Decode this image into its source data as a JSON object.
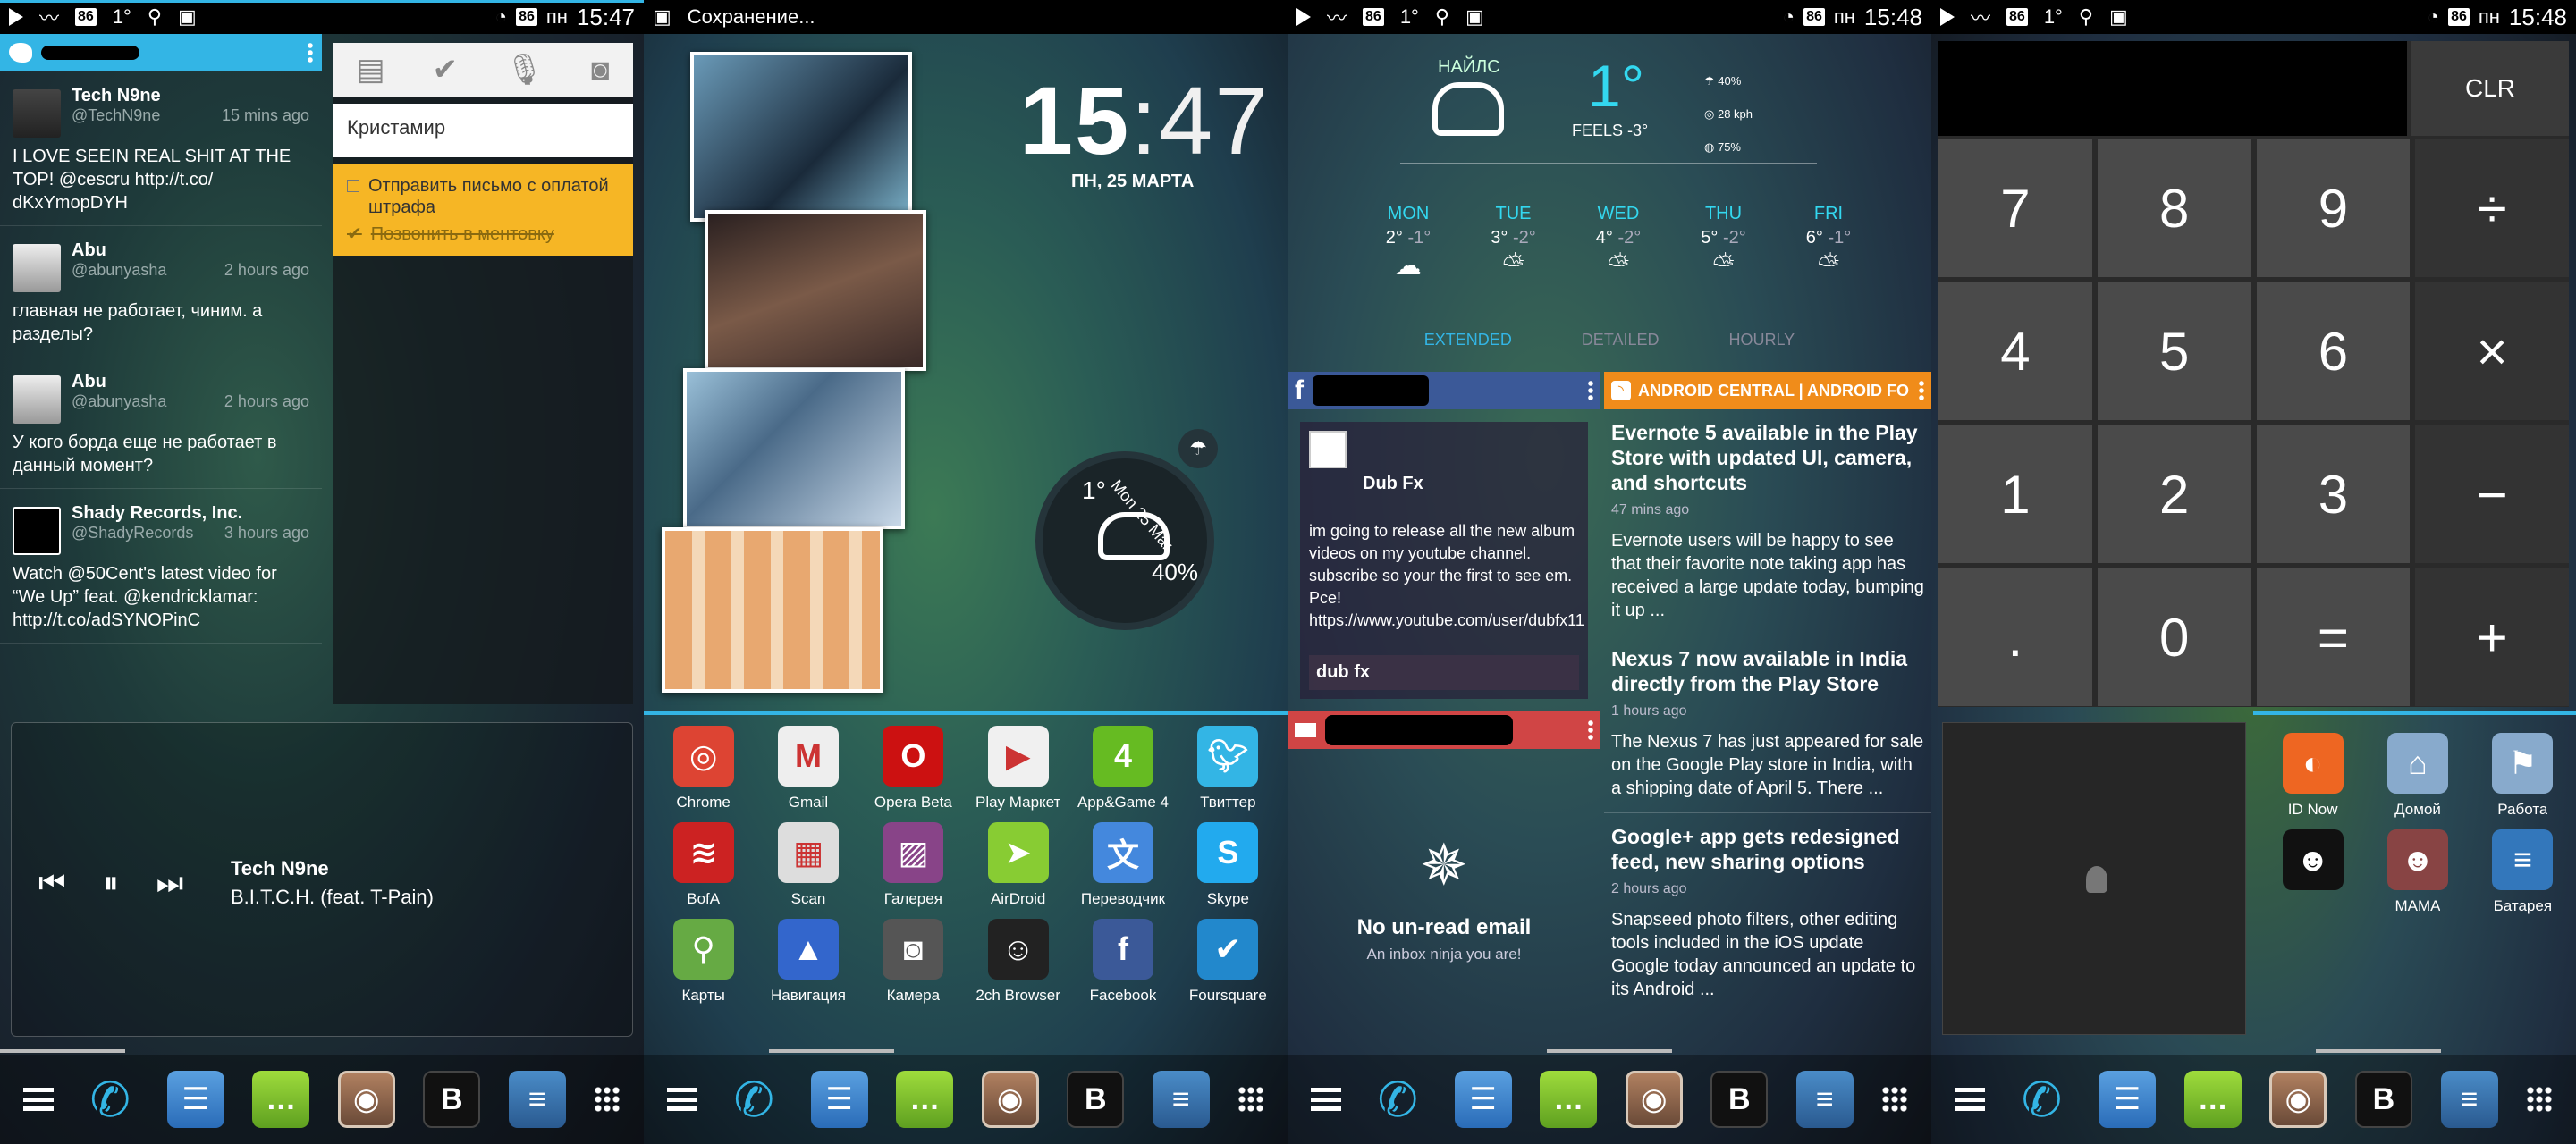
{
  "status_bar": {
    "panel1": {
      "badge_left": "86",
      "one": "1°",
      "badge_right": "86",
      "carrier": "пн",
      "time": "15:47"
    },
    "panel2": {
      "saving": "Сохранение..."
    },
    "panel3": {
      "badge_left": "86",
      "one": "1°",
      "badge_right": "86",
      "carrier": "пн",
      "time": "15:48"
    },
    "panel4": {
      "badge_left": "86",
      "one": "1°",
      "badge_right": "86",
      "carrier": "пн",
      "time": "15:48"
    }
  },
  "twitter": {
    "tweets": [
      {
        "name": "Tech N9ne",
        "handle": "@TechN9ne",
        "time": "15 mins ago",
        "text": "I LOVE SEEIN REAL SHIT AT THE TOP! @cescru http://t.co/ dKxYmopDYH"
      },
      {
        "name": "Abu",
        "handle": "@abunyasha",
        "time": "2 hours ago",
        "text": "главная не работает, чиним. а разделы?"
      },
      {
        "name": "Abu",
        "handle": "@abunyasha",
        "time": "2 hours ago",
        "text": "У кого борда еще не работает в данный момент?"
      },
      {
        "name": "Shady Records, Inc.",
        "handle": "@ShadyRecords",
        "time": "3 hours ago",
        "text": "Watch @50Cent's latest video for “We Up” feat. @kendricklamar: http://t.co/adSYNOPinC"
      }
    ]
  },
  "keep": {
    "note1": "Кристамир",
    "todo": [
      "Отправить письмо с оплатой штрафа",
      "Позвонить в ментовку"
    ]
  },
  "music": {
    "artist": "Tech N9ne",
    "song": "B.I.T.C.H. (feat. T-Pain)"
  },
  "clock": {
    "hours": "15",
    "minutes": "47",
    "date": "ПН, 25 МАРТА"
  },
  "circle_weather": {
    "temp": "1°",
    "date": "Mon 25 Mar",
    "city": "Найлс",
    "pct": "40%",
    "lo": "2°",
    "lo2": "-1°"
  },
  "apps": [
    {
      "label": "Chrome",
      "icon": "chrome-icon",
      "color": "#dd4433"
    },
    {
      "label": "Gmail",
      "icon": "gmail-icon",
      "color": "#eeeeee"
    },
    {
      "label": "Opera Beta",
      "icon": "opera-icon",
      "color": "#cc1111"
    },
    {
      "label": "Play Маркет",
      "icon": "play-store-icon",
      "color": "#f0f0f0"
    },
    {
      "label": "App&Game 4",
      "icon": "four-icon",
      "color": "#66bb22"
    },
    {
      "label": "Твиттер",
      "icon": "twitter-icon",
      "color": "#33b5e5"
    },
    {
      "label": "BofA",
      "icon": "bofa-icon",
      "color": "#cc2222"
    },
    {
      "label": "Scan",
      "icon": "qr-icon",
      "color": "#dddddd"
    },
    {
      "label": "Галерея",
      "icon": "gallery-icon",
      "color": "#884488"
    },
    {
      "label": "AirDroid",
      "icon": "airdroid-icon",
      "color": "#88cc33"
    },
    {
      "label": "Переводчик",
      "icon": "translate-icon",
      "color": "#4488dd"
    },
    {
      "label": "Skype",
      "icon": "skype-icon",
      "color": "#22aaee"
    },
    {
      "label": "Карты",
      "icon": "maps-icon",
      "color": "#66aa44"
    },
    {
      "label": "Навигация",
      "icon": "navigation-icon",
      "color": "#3366cc"
    },
    {
      "label": "Камера",
      "icon": "camera-icon",
      "color": "#555555"
    },
    {
      "label": "2ch Browser",
      "icon": "anon-icon",
      "color": "#222222"
    },
    {
      "label": "Facebook",
      "icon": "facebook-icon",
      "color": "#3b5998"
    },
    {
      "label": "Foursquare",
      "icon": "foursquare-icon",
      "color": "#2288cc"
    }
  ],
  "weather": {
    "city": "НАЙЛС",
    "temp": "1°",
    "feels": "FEELS -3°",
    "stats": [
      "40%",
      "28 kph",
      "75%"
    ],
    "days": [
      {
        "name": "MON",
        "hi": "2°",
        "lo": "-1°"
      },
      {
        "name": "TUE",
        "hi": "3°",
        "lo": "-2°"
      },
      {
        "name": "WED",
        "hi": "4°",
        "lo": "-2°"
      },
      {
        "name": "THU",
        "hi": "5°",
        "lo": "-2°"
      },
      {
        "name": "FRI",
        "hi": "6°",
        "lo": "-1°"
      }
    ],
    "tabs": [
      "EXTENDED",
      "DETAILED",
      "HOURLY"
    ]
  },
  "facebook": {
    "user": "Dub Fx",
    "post": "im going to release all the new album videos on my youtube channel. subscribe so your the first to see em. Pce! https://www.youtube.com/user/dubfx11",
    "link": "dub fx"
  },
  "mail": {
    "title": "No un-read email",
    "subtitle": "An inbox ninja you are!"
  },
  "news": {
    "source": "ANDROID CENTRAL | ANDROID FO",
    "items": [
      {
        "headline": "Evernote 5 available in the Play Store with updated UI, camera, and shortcuts",
        "time": "47 mins ago",
        "body": "Evernote users will be happy to see that their favorite note taking app has received a large update today, bumping it up ..."
      },
      {
        "headline": "Nexus 7 now available in India directly from the Play Store",
        "time": "1 hours ago",
        "body": "The Nexus 7 has just appeared for sale on the Google Play store in India, with a shipping date of April 5. There ..."
      },
      {
        "headline": "Google+ app gets redesigned feed, new sharing options",
        "time": "2 hours ago",
        "body": "Snapseed photo filters, other editing tools included in the iOS update Google today announced an update to its Android ..."
      }
    ]
  },
  "calculator": {
    "clear": "CLR",
    "keys": [
      "7",
      "8",
      "9",
      "÷",
      "4",
      "5",
      "6",
      "×",
      "1",
      "2",
      "3",
      "−",
      ".",
      "0",
      "=",
      "+"
    ]
  },
  "panel4_icons": [
    {
      "label": "ID Now",
      "icon": "idnow-icon",
      "color": "#ee6622"
    },
    {
      "label": "Домой",
      "icon": "maps-home-icon",
      "color": "#88aacc"
    },
    {
      "label": "Работа",
      "icon": "maps-work-icon",
      "color": "#88aacc"
    },
    {
      "label": "",
      "icon": "contact-photo-icon",
      "color": "#111111"
    },
    {
      "label": "МАМА",
      "icon": "contact-mama-icon",
      "color": "#884444"
    },
    {
      "label": "Батарея",
      "icon": "battery-settings-icon",
      "color": "#3377bb"
    }
  ],
  "dock": {
    "b_label": "B"
  }
}
